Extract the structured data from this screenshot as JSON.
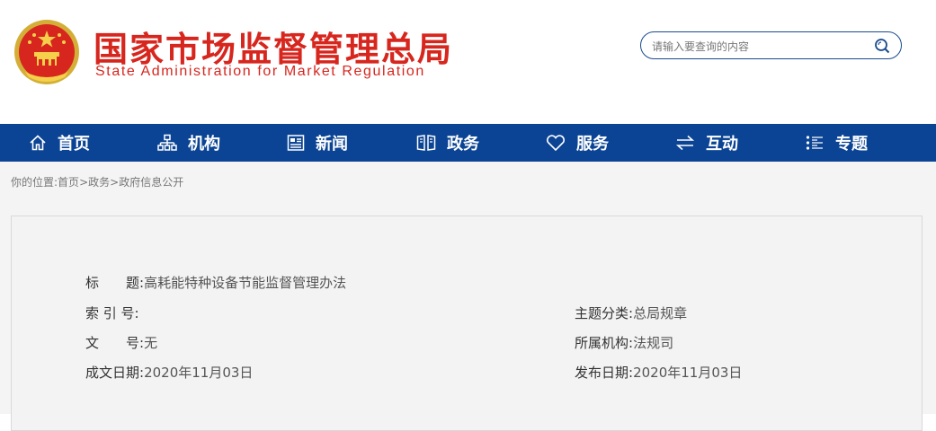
{
  "header": {
    "title_cn": "国家市场监督管理总局",
    "title_en": "State Administration for Market Regulation",
    "search_placeholder": "请输入要查询的内容"
  },
  "nav": [
    {
      "label": "首页",
      "icon": "home-icon"
    },
    {
      "label": "机构",
      "icon": "org-chart-icon"
    },
    {
      "label": "新闻",
      "icon": "news-icon"
    },
    {
      "label": "政务",
      "icon": "book-icon"
    },
    {
      "label": "服务",
      "icon": "heart-icon"
    },
    {
      "label": "互动",
      "icon": "exchange-icon"
    },
    {
      "label": "专题",
      "icon": "topic-list-icon"
    }
  ],
  "breadcrumb": {
    "prefix": "你的位置:",
    "items": [
      "首页",
      "政务",
      "政府信息公开"
    ],
    "sep": ">"
  },
  "info": {
    "title_label": "标　　题:",
    "title_value": "高耗能特种设备节能监督管理办法",
    "index_label": "索 引 号:",
    "index_value": "",
    "doc_label": "文　　号:",
    "doc_value": "无",
    "date_label": "成文日期:",
    "date_value": "2020年11月03日",
    "category_label": "主题分类:",
    "category_value": "总局规章",
    "org_label": "所属机构:",
    "org_value": "法规司",
    "publish_label": "发布日期:",
    "publish_value": "2020年11月03日"
  },
  "colors": {
    "brand_red": "#d7261e",
    "nav_blue": "#0b4494"
  }
}
